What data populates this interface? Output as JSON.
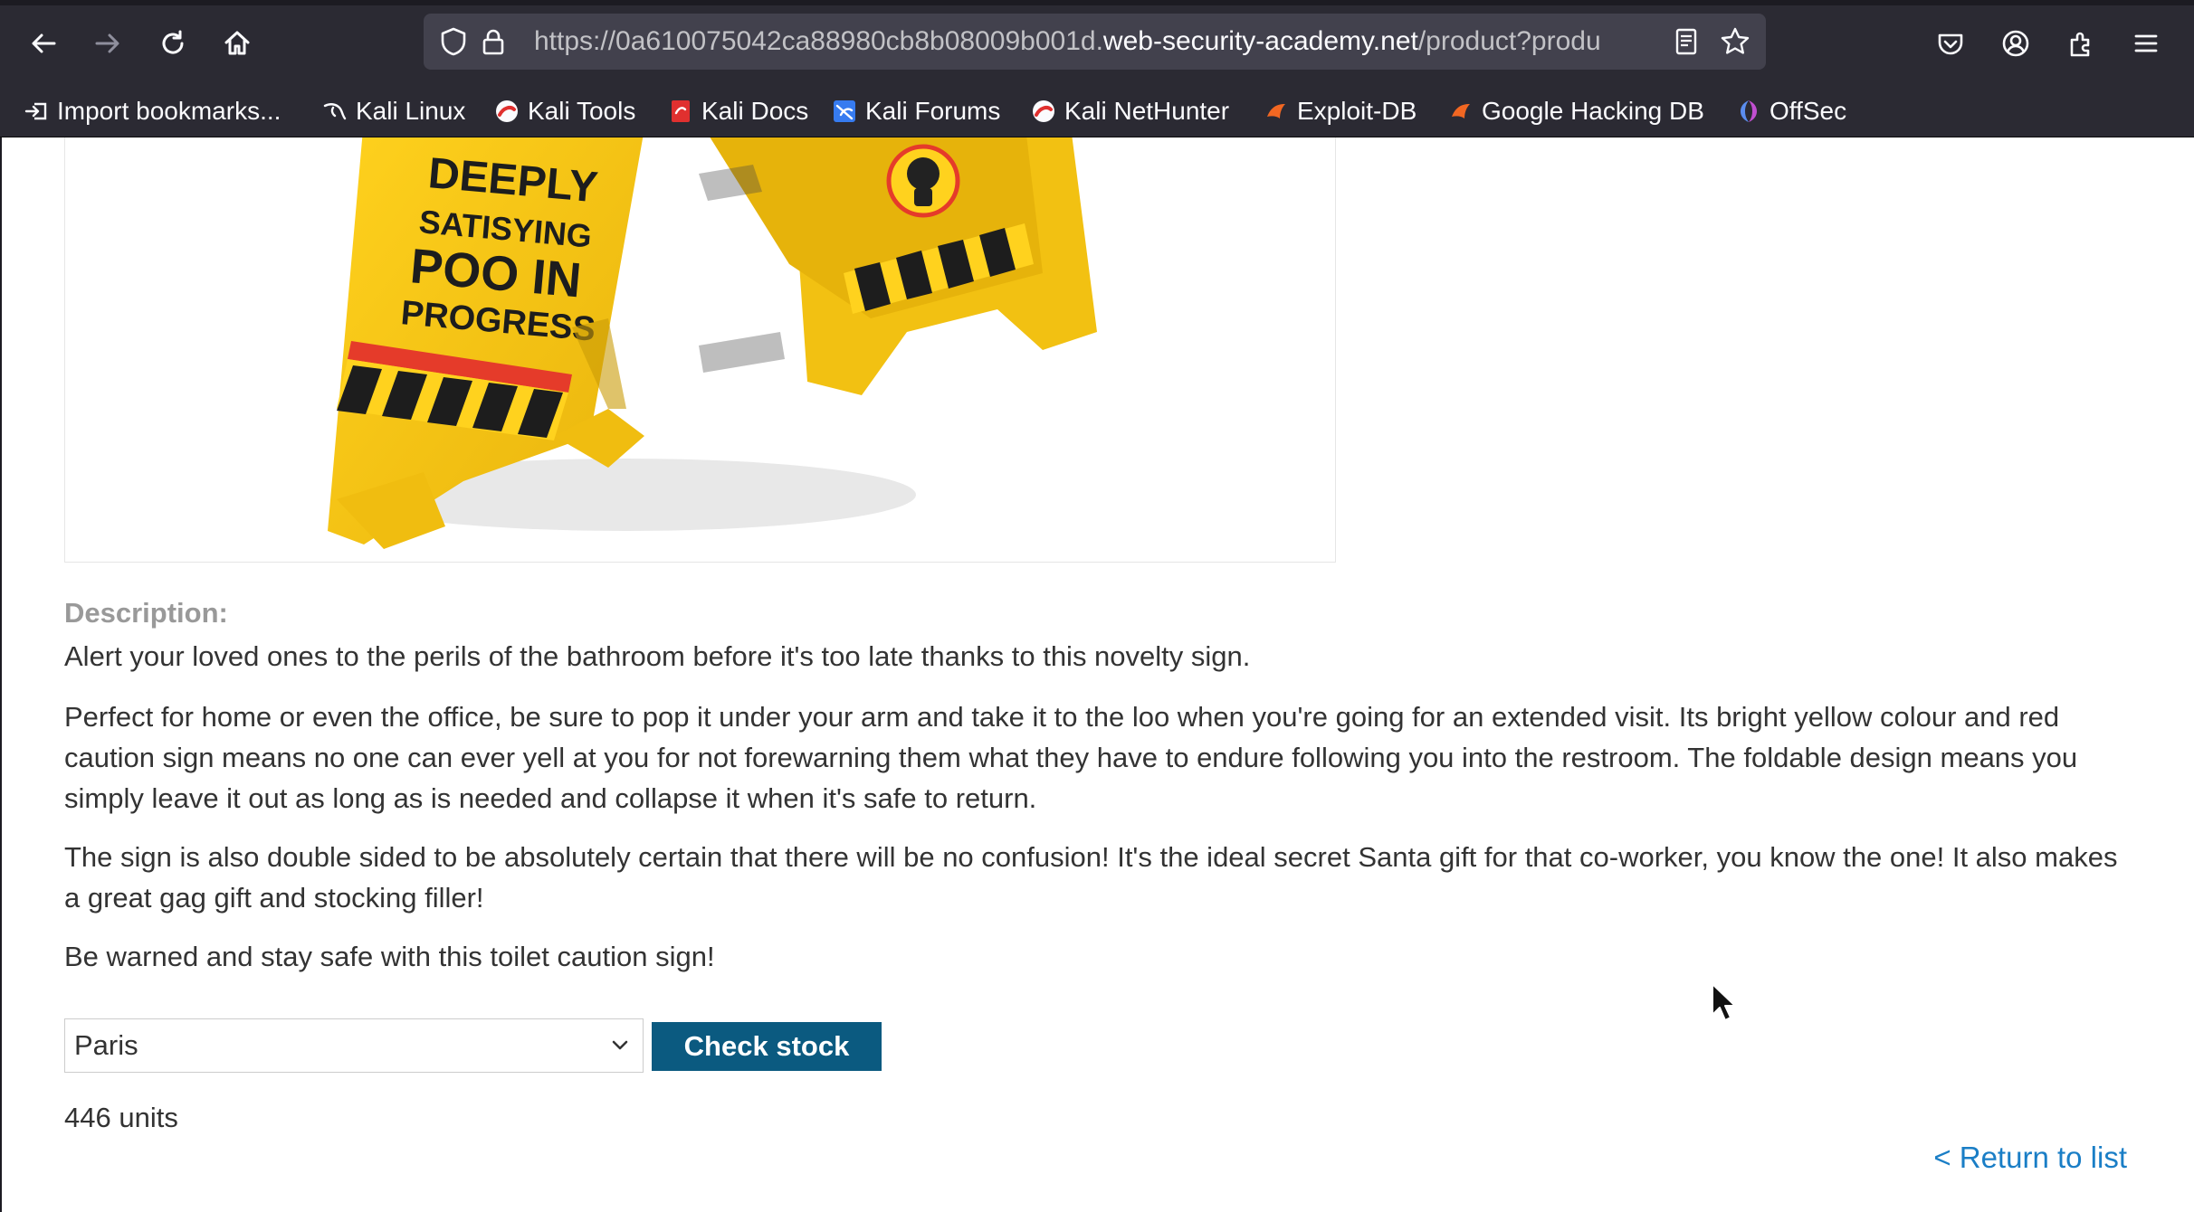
{
  "browser": {
    "url": {
      "prefix": "https://0a610075042ca88980cb8b08009b001d.",
      "domain": "web-security-academy.net",
      "path": "/product?produ"
    },
    "icons": {
      "back": "arrow-left-icon",
      "forward": "arrow-right-icon",
      "reload": "reload-icon",
      "home": "home-icon",
      "tracking_protection": "shield-icon",
      "security": "lock-icon",
      "reader_view": "reader-view-icon",
      "bookmark": "star-icon",
      "pocket": "pocket-icon",
      "account": "account-icon",
      "extensions": "extensions-icon",
      "menu": "hamburger-menu-icon"
    },
    "bookmarks": [
      {
        "label": "Import bookmarks...",
        "icon": "import-icon"
      },
      {
        "label": "Kali Linux",
        "icon": "kali-dragon-icon"
      },
      {
        "label": "Kali Tools",
        "icon": "kali-tools-icon"
      },
      {
        "label": "Kali Docs",
        "icon": "kali-docs-icon"
      },
      {
        "label": "Kali Forums",
        "icon": "kali-forums-icon"
      },
      {
        "label": "Kali NetHunter",
        "icon": "kali-nethunter-icon"
      },
      {
        "label": "Exploit-DB",
        "icon": "exploit-db-icon"
      },
      {
        "label": "Google Hacking DB",
        "icon": "ghdb-icon"
      },
      {
        "label": "OffSec",
        "icon": "offsec-icon"
      }
    ]
  },
  "product": {
    "image_text": [
      "DEEPLY",
      "SATISYING",
      "POO IN",
      "PROGRESS"
    ],
    "description_label": "Description:",
    "paragraphs": [
      "Alert your loved ones to the perils of the bathroom before it's too late thanks to this novelty sign.",
      "Perfect for home or even the office, be sure to pop it under your arm and take it to the loo when you're going for an extended visit. Its bright yellow colour and red caution sign means no one can ever yell at you for not forewarning them what they have to endure following you into the restroom. The foldable design means you simply leave it out as long as is needed and collapse it when it's safe to return.",
      "The sign is also double sided to be absolutely certain that there will be no confusion! It's the ideal secret Santa gift for that co-worker, you know the one! It also makes a great gag gift and stocking filler!",
      "Be warned and stay safe with this toilet caution sign!"
    ],
    "stock": {
      "selected_store": "Paris",
      "check_button": "Check stock",
      "result": "446 units"
    },
    "return_link": "< Return to list"
  },
  "colors": {
    "chrome_bg": "#2b2a33",
    "urlbar_bg": "#42414d",
    "button_blue": "#0b5a80",
    "link_blue": "#1a7ec6",
    "sign_yellow": "#f5c518"
  }
}
